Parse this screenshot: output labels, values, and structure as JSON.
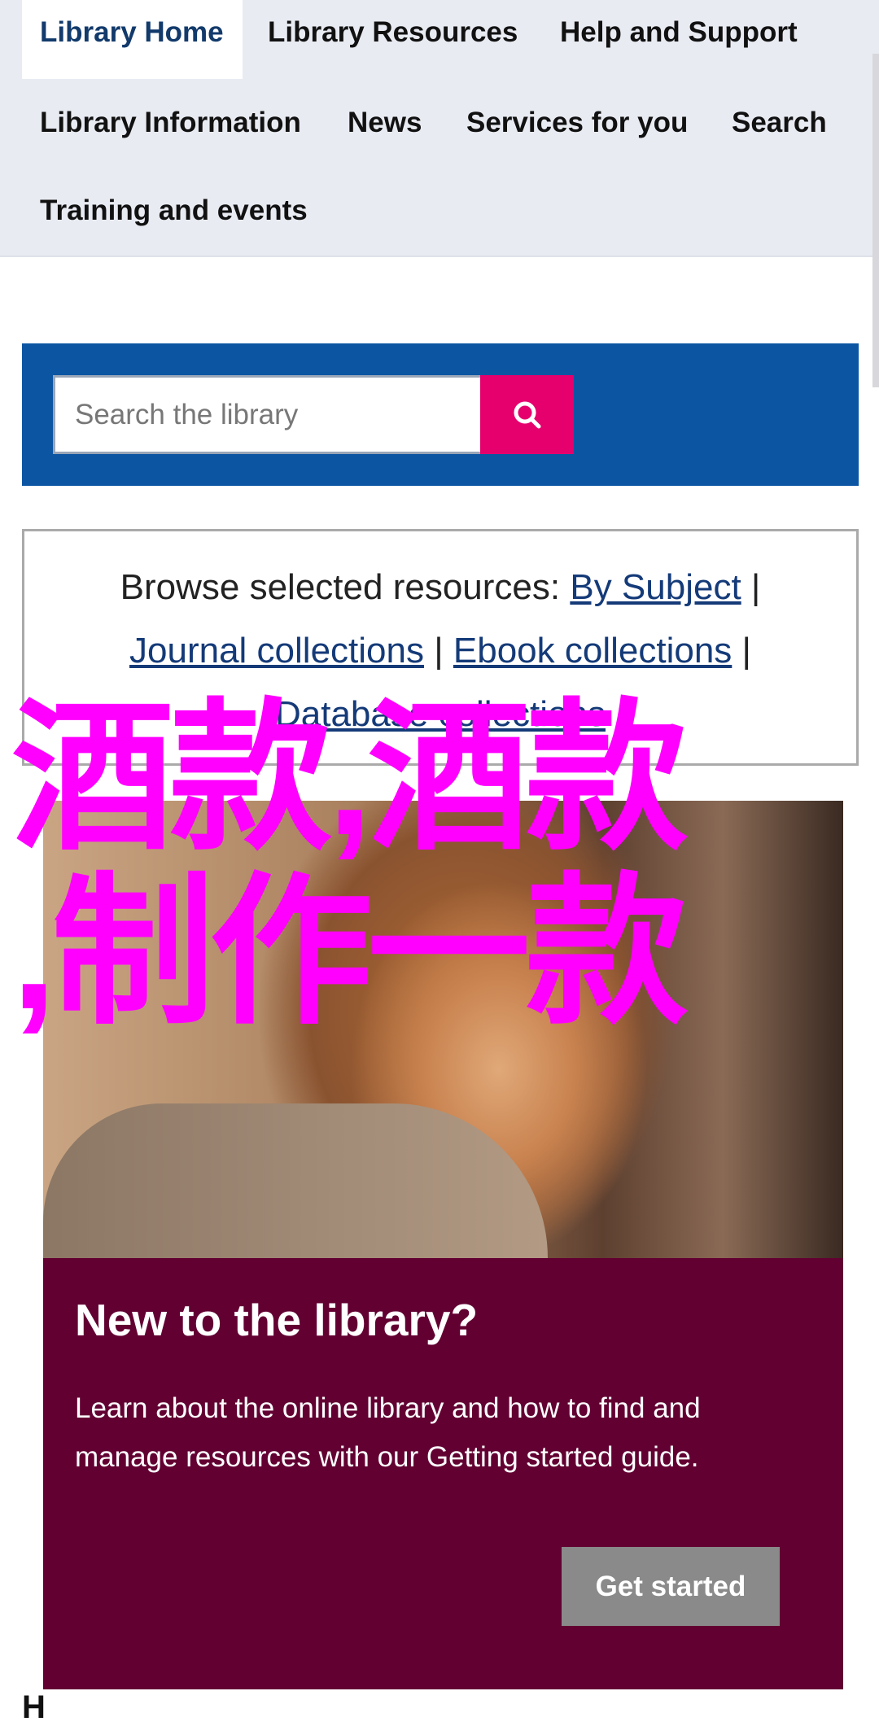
{
  "nav": {
    "items": [
      {
        "label": "Library Home",
        "active": true
      },
      {
        "label": "Library Resources"
      },
      {
        "label": "Help and Support"
      },
      {
        "label": "Library Information"
      },
      {
        "label": "News"
      },
      {
        "label": "Services for you"
      },
      {
        "label": "Search"
      },
      {
        "label": "Training and events"
      }
    ]
  },
  "search": {
    "placeholder": "Search the library",
    "value": "",
    "button_icon": "search-icon"
  },
  "browse": {
    "prefix": "Browse selected resources:",
    "links": [
      "By Subject",
      "Journal collections",
      "Ebook collections",
      "Database collections"
    ],
    "separator": "|"
  },
  "overlay_text": {
    "line1": "酒款,酒款",
    "line2": ",制作一款"
  },
  "promo": {
    "title": "New to the library?",
    "body": "Learn about the online library and how to find and manage resources with our Getting started guide.",
    "button": "Get started"
  },
  "footer_peek": "H",
  "colors": {
    "nav_bg": "#e9ebf3",
    "search_band": "#0b55a3",
    "search_button": "#e5006e",
    "promo_bg": "#620032",
    "link": "#143a78",
    "overlay": "#ff00ff"
  }
}
